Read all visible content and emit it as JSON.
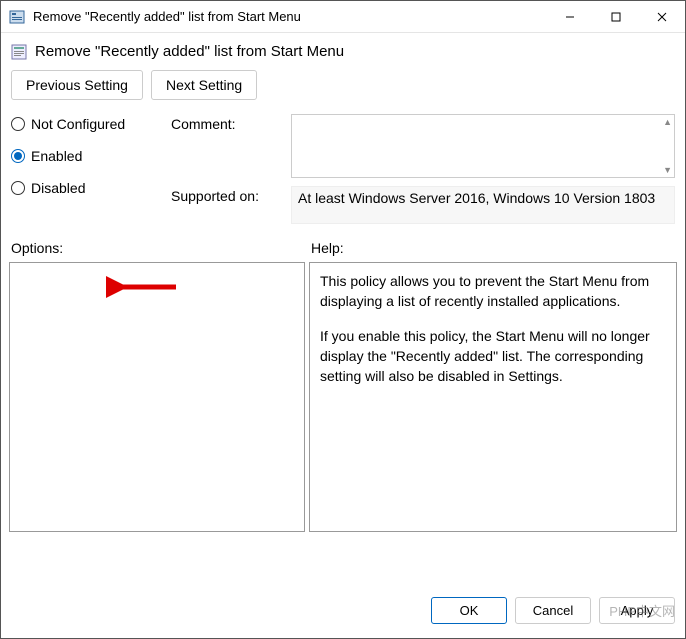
{
  "window": {
    "title": "Remove \"Recently added\" list from Start Menu"
  },
  "header": {
    "title": "Remove \"Recently added\" list from Start Menu"
  },
  "nav": {
    "previous": "Previous Setting",
    "next": "Next Setting"
  },
  "radios": {
    "not_configured": "Not Configured",
    "enabled": "Enabled",
    "disabled": "Disabled",
    "selected": "enabled"
  },
  "labels": {
    "comment": "Comment:",
    "supported_on": "Supported on:",
    "options": "Options:",
    "help": "Help:"
  },
  "fields": {
    "comment": "",
    "supported_on": "At least Windows Server 2016, Windows 10 Version 1803"
  },
  "help": {
    "p1": "This policy allows you to prevent the Start Menu from displaying a list of recently installed applications.",
    "p2": "If you enable this policy, the Start Menu will no longer display the \"Recently added\" list. The corresponding setting will also be disabled in Settings."
  },
  "footer": {
    "ok": "OK",
    "cancel": "Cancel",
    "apply": "Apply"
  },
  "watermark": "PHP中文网"
}
